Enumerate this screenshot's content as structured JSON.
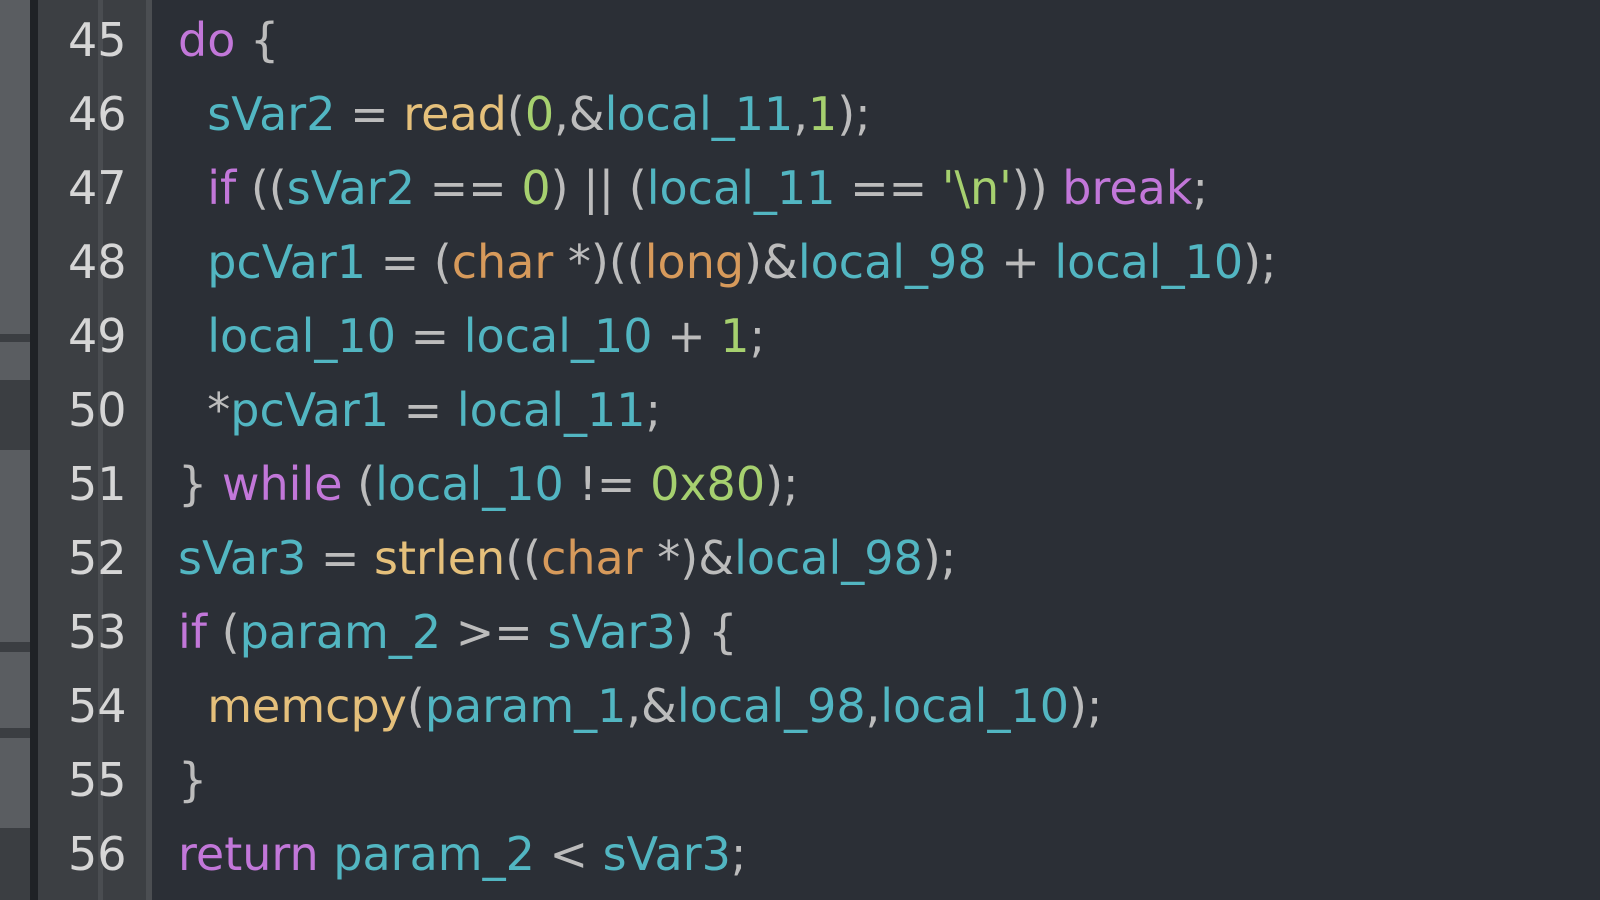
{
  "colors": {
    "background": "#2b2f36",
    "gutter": "#3c3f43",
    "line_number": "#d6d6d6",
    "keyword": "#c277d9",
    "variable": "#52b6c2",
    "function": "#e5c07b",
    "number": "#a6d06f",
    "type": "#d79a5b",
    "punctuation": "#bcbcbc"
  },
  "lines": [
    {
      "number": "45",
      "tokens": [
        {
          "t": "kw",
          "v": "do"
        },
        {
          "t": "punc",
          "v": " {"
        }
      ]
    },
    {
      "number": "46",
      "tokens": [
        {
          "t": "punc",
          "v": "  "
        },
        {
          "t": "var",
          "v": "sVar2"
        },
        {
          "t": "punc",
          "v": " = "
        },
        {
          "t": "fn",
          "v": "read"
        },
        {
          "t": "punc",
          "v": "("
        },
        {
          "t": "num",
          "v": "0"
        },
        {
          "t": "punc",
          "v": ",&"
        },
        {
          "t": "var",
          "v": "local_11"
        },
        {
          "t": "punc",
          "v": ","
        },
        {
          "t": "num",
          "v": "1"
        },
        {
          "t": "punc",
          "v": ");"
        }
      ]
    },
    {
      "number": "47",
      "tokens": [
        {
          "t": "punc",
          "v": "  "
        },
        {
          "t": "kw",
          "v": "if"
        },
        {
          "t": "punc",
          "v": " (("
        },
        {
          "t": "var",
          "v": "sVar2"
        },
        {
          "t": "punc",
          "v": " == "
        },
        {
          "t": "num",
          "v": "0"
        },
        {
          "t": "punc",
          "v": ") || ("
        },
        {
          "t": "var",
          "v": "local_11"
        },
        {
          "t": "punc",
          "v": " == "
        },
        {
          "t": "str",
          "v": "'\\n'"
        },
        {
          "t": "punc",
          "v": ")) "
        },
        {
          "t": "kw",
          "v": "break"
        },
        {
          "t": "punc",
          "v": ";"
        }
      ]
    },
    {
      "number": "48",
      "tokens": [
        {
          "t": "punc",
          "v": "  "
        },
        {
          "t": "var",
          "v": "pcVar1"
        },
        {
          "t": "punc",
          "v": " = ("
        },
        {
          "t": "type",
          "v": "char"
        },
        {
          "t": "punc",
          "v": " *)(("
        },
        {
          "t": "type",
          "v": "long"
        },
        {
          "t": "punc",
          "v": ")&"
        },
        {
          "t": "var",
          "v": "local_98"
        },
        {
          "t": "punc",
          "v": " + "
        },
        {
          "t": "var",
          "v": "local_10"
        },
        {
          "t": "punc",
          "v": ");"
        }
      ]
    },
    {
      "number": "49",
      "tokens": [
        {
          "t": "punc",
          "v": "  "
        },
        {
          "t": "var",
          "v": "local_10"
        },
        {
          "t": "punc",
          "v": " = "
        },
        {
          "t": "var",
          "v": "local_10"
        },
        {
          "t": "punc",
          "v": " + "
        },
        {
          "t": "num",
          "v": "1"
        },
        {
          "t": "punc",
          "v": ";"
        }
      ]
    },
    {
      "number": "50",
      "tokens": [
        {
          "t": "punc",
          "v": "  *"
        },
        {
          "t": "var",
          "v": "pcVar1"
        },
        {
          "t": "punc",
          "v": " = "
        },
        {
          "t": "var",
          "v": "local_11"
        },
        {
          "t": "punc",
          "v": ";"
        }
      ]
    },
    {
      "number": "51",
      "tokens": [
        {
          "t": "punc",
          "v": "} "
        },
        {
          "t": "kw",
          "v": "while"
        },
        {
          "t": "punc",
          "v": " ("
        },
        {
          "t": "var",
          "v": "local_10"
        },
        {
          "t": "punc",
          "v": " != "
        },
        {
          "t": "num",
          "v": "0x80"
        },
        {
          "t": "punc",
          "v": ");"
        }
      ]
    },
    {
      "number": "52",
      "tokens": [
        {
          "t": "var",
          "v": "sVar3"
        },
        {
          "t": "punc",
          "v": " = "
        },
        {
          "t": "fn",
          "v": "strlen"
        },
        {
          "t": "punc",
          "v": "(("
        },
        {
          "t": "type",
          "v": "char"
        },
        {
          "t": "punc",
          "v": " *)&"
        },
        {
          "t": "var",
          "v": "local_98"
        },
        {
          "t": "punc",
          "v": ");"
        }
      ]
    },
    {
      "number": "53",
      "tokens": [
        {
          "t": "kw",
          "v": "if"
        },
        {
          "t": "punc",
          "v": " ("
        },
        {
          "t": "var",
          "v": "param_2"
        },
        {
          "t": "punc",
          "v": " >= "
        },
        {
          "t": "var",
          "v": "sVar3"
        },
        {
          "t": "punc",
          "v": ") {"
        }
      ]
    },
    {
      "number": "54",
      "tokens": [
        {
          "t": "punc",
          "v": "  "
        },
        {
          "t": "fn",
          "v": "memcpy"
        },
        {
          "t": "punc",
          "v": "("
        },
        {
          "t": "var",
          "v": "param_1"
        },
        {
          "t": "punc",
          "v": ",&"
        },
        {
          "t": "var",
          "v": "local_98"
        },
        {
          "t": "punc",
          "v": ","
        },
        {
          "t": "var",
          "v": "local_10"
        },
        {
          "t": "punc",
          "v": ");"
        }
      ]
    },
    {
      "number": "55",
      "tokens": [
        {
          "t": "punc",
          "v": "}"
        }
      ]
    },
    {
      "number": "56",
      "tokens": [
        {
          "t": "kw",
          "v": "return"
        },
        {
          "t": "punc",
          "v": " "
        },
        {
          "t": "var",
          "v": "param_2"
        },
        {
          "t": "punc",
          "v": " < "
        },
        {
          "t": "var",
          "v": "sVar3"
        },
        {
          "t": "punc",
          "v": ";"
        }
      ]
    }
  ]
}
